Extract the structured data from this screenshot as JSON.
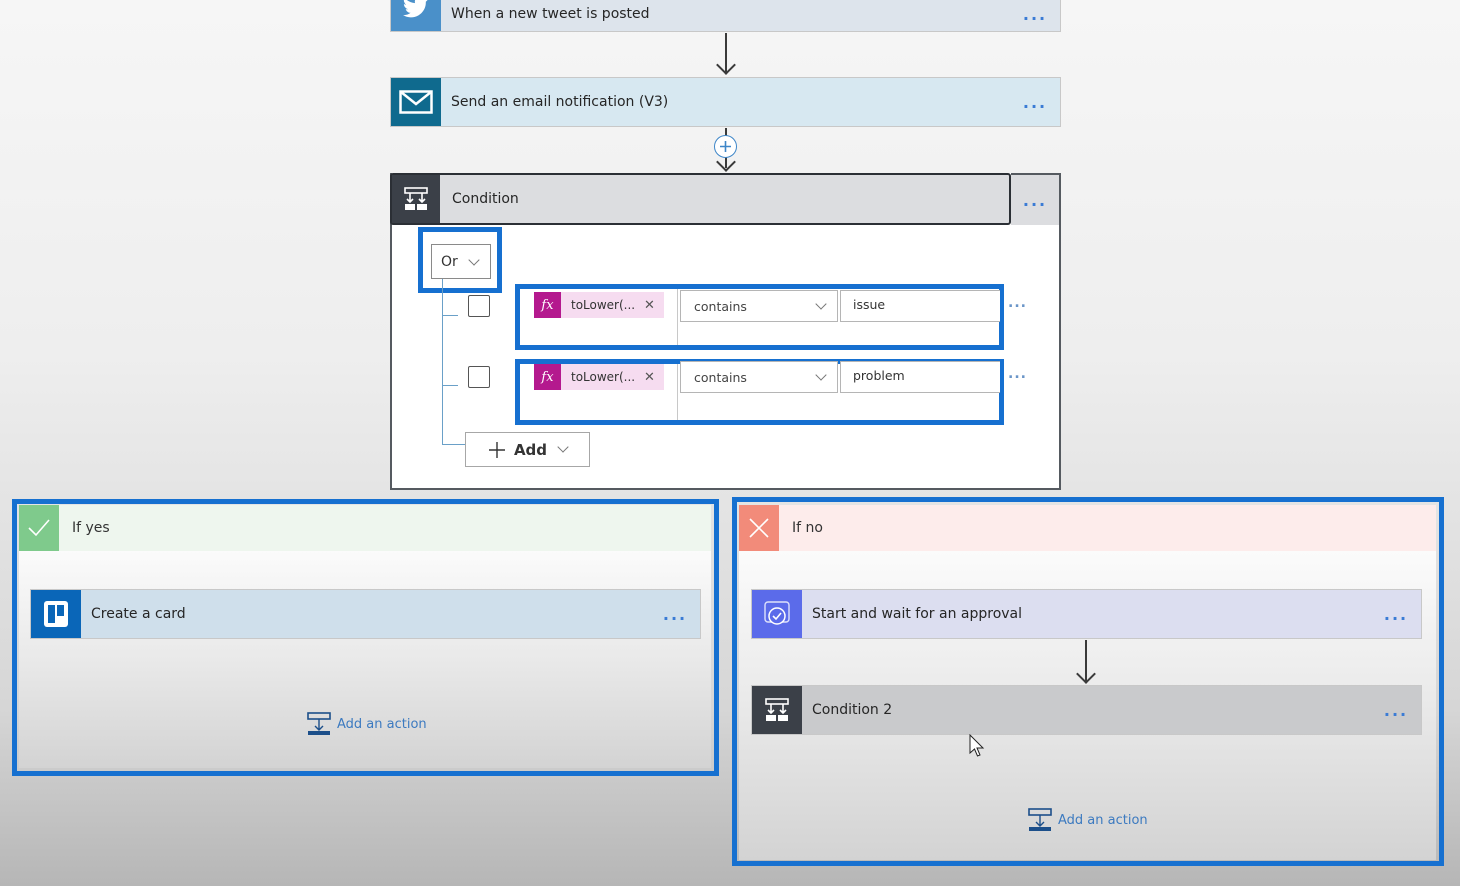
{
  "flow": {
    "trigger": {
      "title": "When a new tweet is posted",
      "icon": "twitter-icon",
      "color": "#4a90c9"
    },
    "email_action": {
      "title": "Send an email notification (V3)",
      "icon": "mail-icon",
      "color": "#0f6a8e"
    },
    "condition": {
      "title": "Condition",
      "icon": "condition-icon",
      "group_operator": "Or",
      "rows": [
        {
          "token": "toLower(...",
          "operator": "contains",
          "value": "issue"
        },
        {
          "token": "toLower(...",
          "operator": "contains",
          "value": "problem"
        }
      ],
      "add_label": "Add"
    },
    "if_yes": {
      "label": "If yes",
      "header_color": "#7fca8c",
      "actions": [
        {
          "title": "Create a card",
          "icon": "trello-icon",
          "color": "#0a66b8"
        }
      ],
      "add_action_label": "Add an action"
    },
    "if_no": {
      "label": "If no",
      "header_color": "#f28b7a",
      "actions": [
        {
          "title": "Start and wait for an approval",
          "icon": "approval-icon",
          "color": "#5b6bea"
        },
        {
          "title": "Condition 2",
          "icon": "condition-icon",
          "color": "#3b4048"
        }
      ],
      "add_action_label": "Add an action"
    },
    "more_label": "...",
    "highlight_color": "#1670d0"
  }
}
